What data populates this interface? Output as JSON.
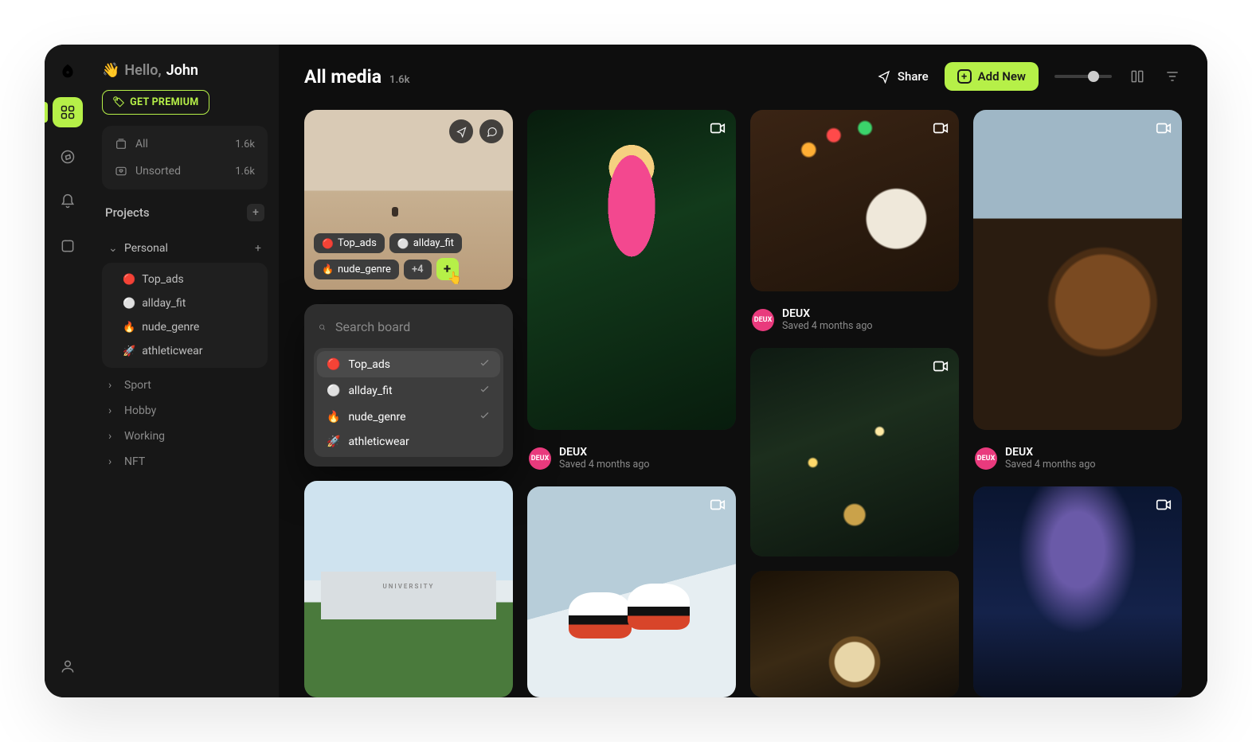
{
  "greeting": {
    "wave": "👋",
    "prefix": "Hello,",
    "name": "John"
  },
  "premium_label": "GET PREMIUM",
  "library": {
    "all": {
      "label": "All",
      "count": "1.6k"
    },
    "unsorted": {
      "label": "Unsorted",
      "count": "1.6k"
    }
  },
  "projects": {
    "title": "Projects",
    "items": [
      {
        "label": "Personal",
        "open": true,
        "children": [
          {
            "emoji": "🔴",
            "label": "Top_ads"
          },
          {
            "emoji": "⚪",
            "label": "allday_fit"
          },
          {
            "emoji": "🔥",
            "label": "nude_genre"
          },
          {
            "emoji": "🚀",
            "label": "athleticwear"
          }
        ]
      },
      {
        "label": "Sport"
      },
      {
        "label": "Hobby"
      },
      {
        "label": "Working"
      },
      {
        "label": "NFT"
      }
    ]
  },
  "page": {
    "title": "All media",
    "count": "1.6k"
  },
  "actions": {
    "share": "Share",
    "addnew": "Add New"
  },
  "card_tags": [
    {
      "emoji": "🔴",
      "label": "Top_ads"
    },
    {
      "emoji": "⚪",
      "label": "allday_fit"
    },
    {
      "emoji": "🔥",
      "label": "nude_genre"
    }
  ],
  "card_tag_more": "+4",
  "search": {
    "placeholder": "Search board"
  },
  "board_options": [
    {
      "emoji": "🔴",
      "label": "Top_ads",
      "checked": true,
      "selected": true
    },
    {
      "emoji": "⚪",
      "label": "allday_fit",
      "checked": true
    },
    {
      "emoji": "🔥",
      "label": "nude_genre",
      "checked": true
    },
    {
      "emoji": "🚀",
      "label": "athleticwear",
      "checked": false
    }
  ],
  "author": {
    "name": "DEUX",
    "saved": "Saved 4 months ago",
    "avatar": "DEUX"
  }
}
